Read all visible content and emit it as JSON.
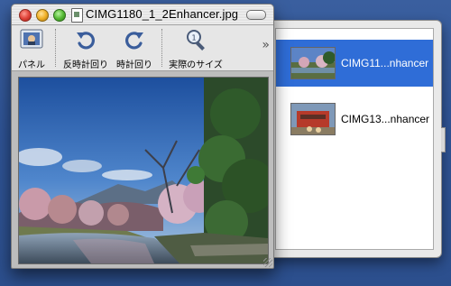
{
  "window": {
    "title": "CIMG1180_1_2Enhancer.jpg"
  },
  "toolbar": {
    "panel_label": "パネル",
    "rotate_left_label": "反時計回り",
    "rotate_right_label": "時計回り",
    "actual_size_label": "実際のサイズ",
    "overflow_symbol": "»"
  },
  "drawer": {
    "items": [
      {
        "label": "CIMG11...nhancer",
        "selected": true
      },
      {
        "label": "CIMG13...nhancer",
        "selected": false
      }
    ]
  },
  "colors": {
    "desktop": "#2f5496",
    "selection": "#2f6dd7",
    "close": "#e0443a",
    "minimize": "#f1b127",
    "zoom": "#56bb35"
  },
  "icons": {
    "panel": "panel-icon",
    "rotate_left": "rotate-counterclockwise-icon",
    "rotate_right": "rotate-clockwise-icon",
    "actual_size": "magnifier-icon"
  }
}
